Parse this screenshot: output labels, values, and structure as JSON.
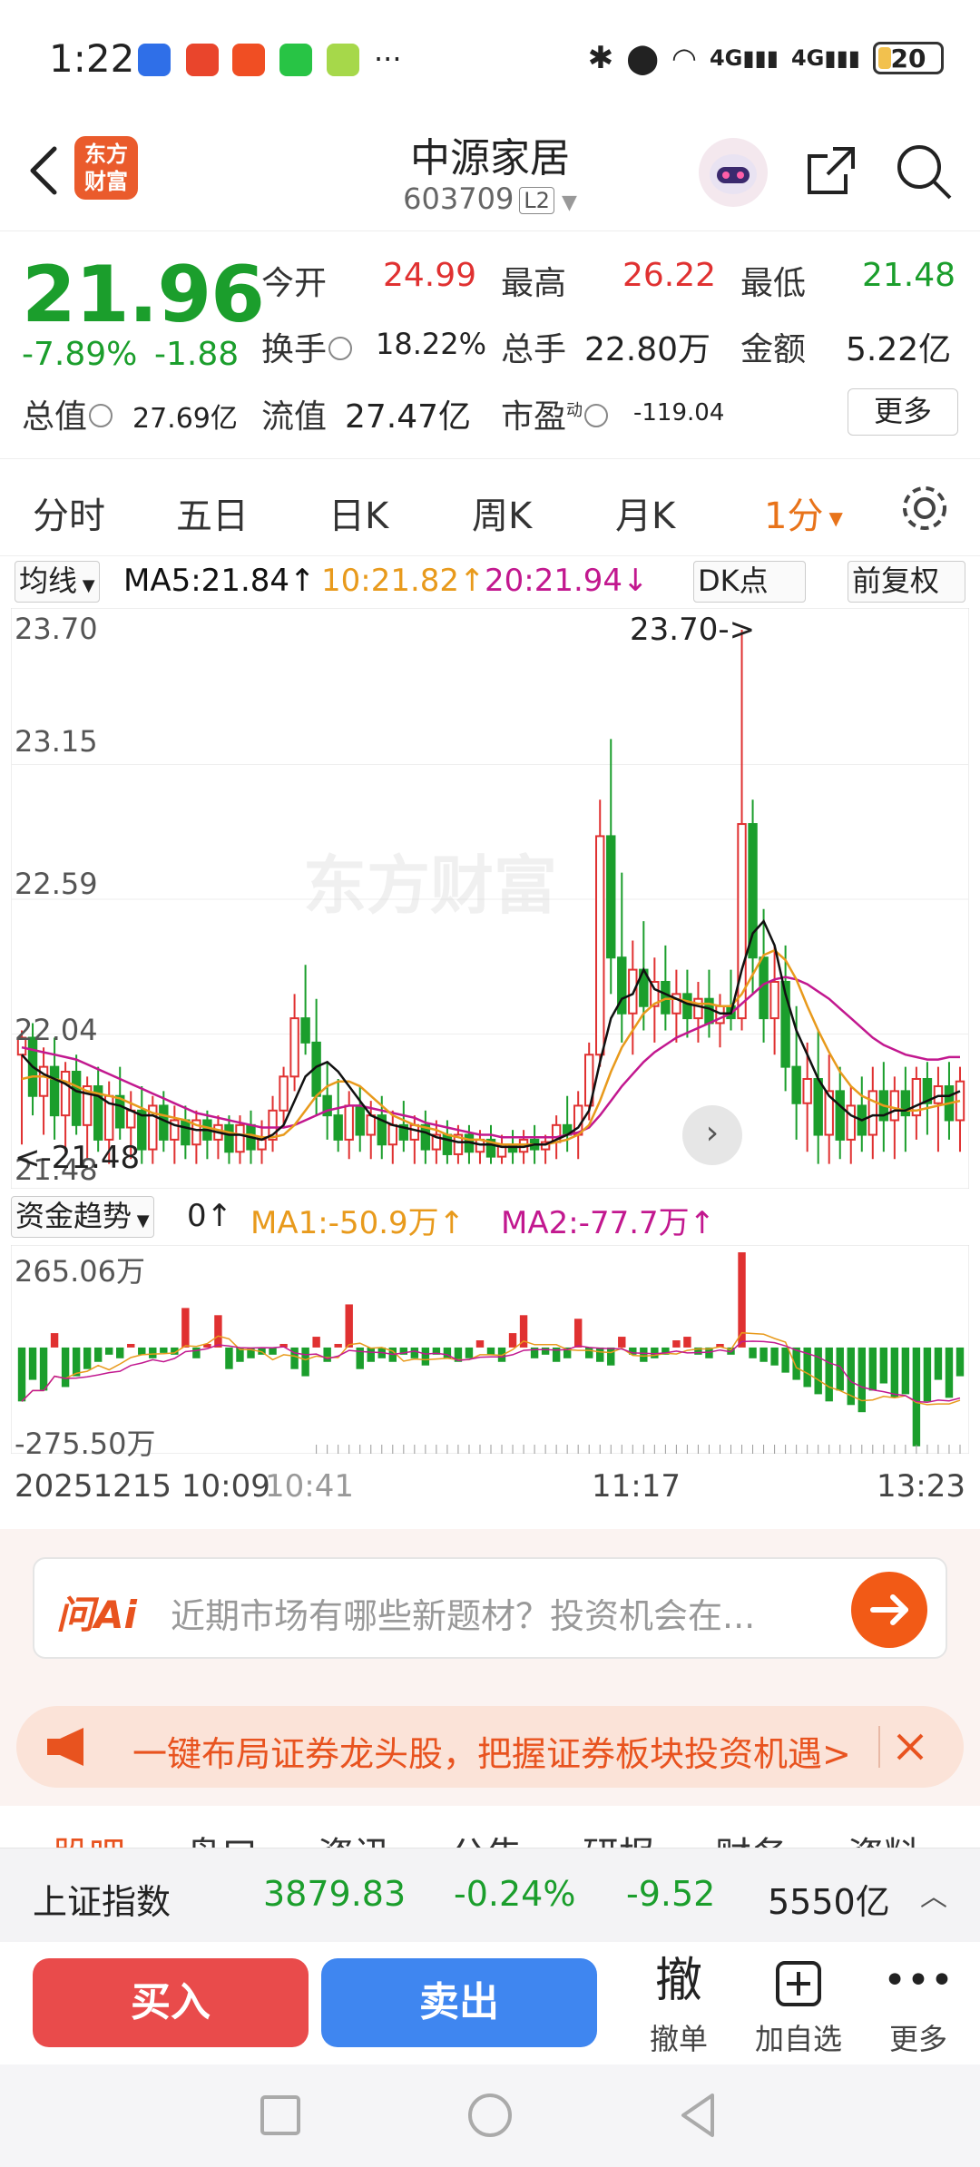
{
  "status_bar": {
    "time": "1:22",
    "more_dots": "···",
    "battery": "20",
    "net1": "4G",
    "net2": "4G"
  },
  "header": {
    "logo_line1": "东方",
    "logo_line2": "财富",
    "name": "中源家居",
    "code": "603709",
    "level": "L2"
  },
  "quote": {
    "price": "21.96",
    "pct": "-7.89%",
    "change": "-1.88",
    "open_label": "今开",
    "open": "24.99",
    "high_label": "最高",
    "high": "26.22",
    "low_label": "最低",
    "low": "21.48",
    "turnover_label": "换手",
    "turnover": "18.22%",
    "volume_label": "总手",
    "volume": "22.80万",
    "amount_label": "金额",
    "amount": "5.22亿",
    "mktcap_label": "总值",
    "mktcap": "27.69亿",
    "float_label": "流值",
    "float": "27.47亿",
    "pe_label": "市盈",
    "pe_sup": "动",
    "pe": "-119.04",
    "more": "更多"
  },
  "period_tabs": [
    "分时",
    "五日",
    "日K",
    "周K",
    "月K",
    "1分"
  ],
  "chart_toolbar": {
    "ma_select": "均线",
    "ma5": "MA5:21.84",
    "ma10": "10:21.82",
    "ma20": "20:21.94",
    "dk": "DK点",
    "adjust": "前复权"
  },
  "price_axis": [
    "23.70",
    "23.15",
    "22.59",
    "22.04",
    "21.48"
  ],
  "annotations": {
    "max_marker": "23.70",
    "min_marker": "21.48"
  },
  "watermark": "东方财富",
  "flow_toolbar": {
    "select": "资金趋势",
    "value": "0",
    "ma1": "MA1:-50.9万",
    "ma2": "MA2:-77.7万"
  },
  "flow_axis": [
    "265.06万",
    "-275.50万"
  ],
  "time_axis": {
    "start": "20251215 10:09",
    "t1": "10:41",
    "t2": "11:17",
    "end": "13:23"
  },
  "ai": {
    "logo": "问Ai",
    "placeholder": "近期市场有哪些新题材？投资机会在..."
  },
  "promo": {
    "text": "一键布局证券龙头股，把握证券板块投资机遇>"
  },
  "sub_tabs": [
    "股吧",
    "盘口",
    "资讯",
    "公告",
    "研报",
    "财务",
    "资料"
  ],
  "index_bar": {
    "name": "上证指数",
    "value": "3879.83",
    "pct": "-0.24%",
    "change": "-9.52",
    "amount": "5550亿"
  },
  "trade_bar": {
    "buy": "买入",
    "sell": "卖出",
    "cancel_icon": "撤",
    "cancel": "撤单",
    "watchlist": "加自选",
    "more": "更多"
  },
  "colors": {
    "up": "#e03131",
    "down": "#1b9e2c",
    "accent": "#e8731a",
    "ma5": "#111111",
    "ma10": "#e89a1c",
    "ma20": "#c2188f"
  },
  "chart_data": {
    "type": "candlestick",
    "ylim": [
      21.48,
      23.7
    ],
    "candles": [
      [
        21.95,
        22.05,
        21.58,
        22.02
      ],
      [
        22.02,
        22.08,
        21.7,
        21.78
      ],
      [
        21.78,
        21.98,
        21.62,
        21.9
      ],
      [
        21.9,
        22.02,
        21.6,
        21.7
      ],
      [
        21.7,
        21.92,
        21.55,
        21.88
      ],
      [
        21.88,
        21.95,
        21.62,
        21.66
      ],
      [
        21.66,
        21.86,
        21.52,
        21.82
      ],
      [
        21.82,
        21.9,
        21.55,
        21.6
      ],
      [
        21.6,
        21.84,
        21.5,
        21.78
      ],
      [
        21.78,
        21.9,
        21.6,
        21.65
      ],
      [
        21.65,
        21.8,
        21.52,
        21.72
      ],
      [
        21.72,
        21.82,
        21.5,
        21.56
      ],
      [
        21.56,
        21.78,
        21.5,
        21.74
      ],
      [
        21.74,
        21.8,
        21.55,
        21.6
      ],
      [
        21.6,
        21.74,
        21.5,
        21.68
      ],
      [
        21.68,
        21.74,
        21.52,
        21.58
      ],
      [
        21.58,
        21.72,
        21.5,
        21.68
      ],
      [
        21.68,
        21.72,
        21.52,
        21.6
      ],
      [
        21.6,
        21.7,
        21.52,
        21.66
      ],
      [
        21.66,
        21.7,
        21.5,
        21.55
      ],
      [
        21.55,
        21.7,
        21.5,
        21.66
      ],
      [
        21.66,
        21.72,
        21.5,
        21.56
      ],
      [
        21.56,
        21.68,
        21.5,
        21.6
      ],
      [
        21.6,
        21.78,
        21.55,
        21.72
      ],
      [
        21.72,
        21.9,
        21.65,
        21.86
      ],
      [
        21.86,
        22.2,
        21.8,
        22.1
      ],
      [
        22.1,
        22.32,
        21.95,
        22.0
      ],
      [
        22.0,
        22.18,
        21.7,
        21.78
      ],
      [
        21.78,
        21.92,
        21.6,
        21.7
      ],
      [
        21.7,
        21.85,
        21.55,
        21.6
      ],
      [
        21.6,
        21.8,
        21.52,
        21.74
      ],
      [
        21.74,
        21.82,
        21.55,
        21.62
      ],
      [
        21.62,
        21.76,
        21.52,
        21.7
      ],
      [
        21.7,
        21.78,
        21.52,
        21.58
      ],
      [
        21.58,
        21.72,
        21.5,
        21.66
      ],
      [
        21.66,
        21.76,
        21.55,
        21.6
      ],
      [
        21.6,
        21.7,
        21.5,
        21.66
      ],
      [
        21.66,
        21.72,
        21.5,
        21.56
      ],
      [
        21.56,
        21.68,
        21.5,
        21.62
      ],
      [
        21.62,
        21.68,
        21.5,
        21.54
      ],
      [
        21.54,
        21.66,
        21.5,
        21.62
      ],
      [
        21.62,
        21.66,
        21.5,
        21.55
      ],
      [
        21.55,
        21.64,
        21.5,
        21.6
      ],
      [
        21.6,
        21.66,
        21.5,
        21.53
      ],
      [
        21.53,
        21.62,
        21.5,
        21.58
      ],
      [
        21.58,
        21.64,
        21.5,
        21.55
      ],
      [
        21.55,
        21.64,
        21.5,
        21.6
      ],
      [
        21.6,
        21.66,
        21.5,
        21.56
      ],
      [
        21.56,
        21.62,
        21.5,
        21.59
      ],
      [
        21.59,
        21.7,
        21.52,
        21.66
      ],
      [
        21.66,
        21.78,
        21.55,
        21.62
      ],
      [
        21.62,
        21.8,
        21.52,
        21.74
      ],
      [
        21.74,
        22.0,
        21.68,
        21.95
      ],
      [
        21.95,
        23.0,
        21.9,
        22.85
      ],
      [
        22.85,
        23.25,
        22.2,
        22.35
      ],
      [
        22.35,
        22.7,
        22.0,
        22.12
      ],
      [
        22.12,
        22.42,
        21.95,
        22.3
      ],
      [
        22.3,
        22.5,
        22.05,
        22.15
      ],
      [
        22.15,
        22.35,
        22.0,
        22.25
      ],
      [
        22.25,
        22.4,
        22.05,
        22.12
      ],
      [
        22.12,
        22.3,
        22.0,
        22.2
      ],
      [
        22.2,
        22.3,
        22.02,
        22.1
      ],
      [
        22.1,
        22.25,
        22.0,
        22.18
      ],
      [
        22.18,
        22.3,
        22.02,
        22.08
      ],
      [
        22.08,
        22.2,
        21.98,
        22.15
      ],
      [
        22.15,
        22.3,
        22.05,
        22.1
      ],
      [
        22.1,
        23.7,
        22.05,
        22.9
      ],
      [
        22.9,
        23.0,
        22.2,
        22.35
      ],
      [
        22.35,
        22.55,
        22.0,
        22.1
      ],
      [
        22.1,
        22.4,
        21.95,
        22.25
      ],
      [
        22.25,
        22.4,
        21.8,
        21.9
      ],
      [
        21.9,
        22.15,
        21.6,
        21.75
      ],
      [
        21.75,
        22.0,
        21.55,
        21.85
      ],
      [
        21.85,
        22.05,
        21.5,
        21.62
      ],
      [
        21.62,
        21.95,
        21.5,
        21.8
      ],
      [
        21.8,
        21.9,
        21.52,
        21.6
      ],
      [
        21.6,
        21.82,
        21.5,
        21.74
      ],
      [
        21.74,
        21.86,
        21.55,
        21.62
      ],
      [
        21.62,
        21.9,
        21.52,
        21.8
      ],
      [
        21.8,
        21.92,
        21.55,
        21.68
      ],
      [
        21.68,
        21.86,
        21.52,
        21.8
      ],
      [
        21.8,
        21.9,
        21.55,
        21.7
      ],
      [
        21.7,
        21.9,
        21.6,
        21.85
      ],
      [
        21.85,
        21.92,
        21.62,
        21.75
      ],
      [
        21.75,
        21.9,
        21.55,
        21.82
      ],
      [
        21.82,
        21.92,
        21.6,
        21.68
      ],
      [
        21.68,
        21.9,
        21.55,
        21.84
      ]
    ],
    "ma5": [
      21.95,
      21.9,
      21.87,
      21.85,
      21.83,
      21.8,
      21.79,
      21.78,
      21.75,
      21.74,
      21.72,
      21.7,
      21.7,
      21.68,
      21.66,
      21.65,
      21.64,
      21.64,
      21.63,
      21.62,
      21.62,
      21.61,
      21.6,
      21.62,
      21.66,
      21.76,
      21.86,
      21.9,
      21.92,
      21.88,
      21.82,
      21.76,
      21.7,
      21.68,
      21.66,
      21.65,
      21.64,
      21.63,
      21.61,
      21.6,
      21.59,
      21.59,
      21.58,
      21.58,
      21.57,
      21.57,
      21.57,
      21.58,
      21.58,
      21.6,
      21.62,
      21.65,
      21.72,
      21.92,
      22.1,
      22.18,
      22.2,
      22.3,
      22.22,
      22.2,
      22.18,
      22.16,
      22.15,
      22.14,
      22.12,
      22.12,
      22.3,
      22.45,
      22.5,
      22.4,
      22.2,
      22.05,
      21.95,
      21.85,
      21.78,
      21.74,
      21.7,
      21.68,
      21.7,
      21.7,
      21.72,
      21.72,
      21.74,
      21.76,
      21.78,
      21.78,
      21.8
    ],
    "ma10": [
      21.85,
      21.86,
      21.86,
      21.85,
      21.84,
      21.82,
      21.8,
      21.79,
      21.78,
      21.77,
      21.75,
      21.73,
      21.71,
      21.7,
      21.69,
      21.68,
      21.66,
      21.65,
      21.64,
      21.63,
      21.62,
      21.62,
      21.61,
      21.61,
      21.62,
      21.66,
      21.72,
      21.78,
      21.82,
      21.84,
      21.84,
      21.82,
      21.78,
      21.74,
      21.7,
      21.68,
      21.66,
      21.65,
      21.64,
      21.62,
      21.61,
      21.6,
      21.6,
      21.59,
      21.58,
      21.58,
      21.58,
      21.58,
      21.58,
      21.59,
      21.6,
      21.62,
      21.66,
      21.76,
      21.88,
      21.98,
      22.05,
      22.12,
      22.16,
      22.18,
      22.18,
      22.17,
      22.16,
      22.16,
      22.15,
      22.15,
      22.2,
      22.28,
      22.36,
      22.38,
      22.34,
      22.26,
      22.15,
      22.05,
      21.96,
      21.88,
      21.82,
      21.78,
      21.76,
      21.74,
      21.73,
      21.72,
      21.72,
      21.73,
      21.74,
      21.75,
      21.76
    ],
    "ma20": [
      21.98,
      21.97,
      21.96,
      21.95,
      21.94,
      21.93,
      21.91,
      21.89,
      21.87,
      21.85,
      21.83,
      21.81,
      21.79,
      21.77,
      21.75,
      21.73,
      21.71,
      21.7,
      21.69,
      21.68,
      21.67,
      21.66,
      21.65,
      21.65,
      21.65,
      21.66,
      21.68,
      21.7,
      21.72,
      21.73,
      21.74,
      21.74,
      21.73,
      21.72,
      21.71,
      21.7,
      21.69,
      21.67,
      21.66,
      21.65,
      21.64,
      21.63,
      21.62,
      21.62,
      21.61,
      21.61,
      21.61,
      21.61,
      21.61,
      21.61,
      21.62,
      21.63,
      21.65,
      21.7,
      21.76,
      21.82,
      21.87,
      21.92,
      21.96,
      21.99,
      22.02,
      22.04,
      22.06,
      22.08,
      22.1,
      22.12,
      22.16,
      22.2,
      22.24,
      22.26,
      22.27,
      22.26,
      22.24,
      22.21,
      22.18,
      22.14,
      22.1,
      22.06,
      22.02,
      21.99,
      21.97,
      21.95,
      21.94,
      21.93,
      21.93,
      21.94,
      21.94
    ],
    "flow": [
      -150,
      -90,
      -120,
      40,
      -110,
      -80,
      -60,
      -40,
      -20,
      -30,
      10,
      -20,
      -30,
      -15,
      -20,
      110,
      -30,
      10,
      90,
      -60,
      -40,
      -30,
      -20,
      -20,
      10,
      -60,
      -80,
      30,
      -40,
      10,
      120,
      -60,
      -40,
      -30,
      -40,
      -20,
      -30,
      -50,
      -20,
      -30,
      -40,
      -30,
      20,
      -20,
      -40,
      40,
      90,
      -30,
      -20,
      -40,
      -30,
      80,
      -30,
      -40,
      -50,
      30,
      -20,
      -40,
      -30,
      -20,
      20,
      30,
      -20,
      -30,
      10,
      -20,
      265,
      -30,
      -40,
      -50,
      -70,
      -90,
      -110,
      -130,
      -150,
      -120,
      -160,
      -180,
      -120,
      -100,
      -140,
      -130,
      -275,
      -150,
      -90,
      -140,
      -80
    ],
    "flow_ylim": [
      -275.5,
      265.06
    ]
  }
}
